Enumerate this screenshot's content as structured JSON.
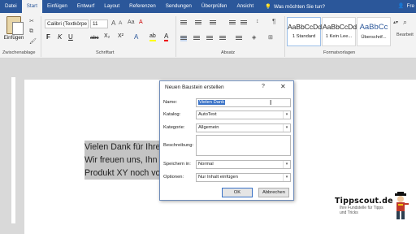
{
  "ribbon_tabs": {
    "file": "Datei",
    "home": "Start",
    "insert": "Einfügen",
    "design": "Entwurf",
    "layout": "Layout",
    "references": "Referenzen",
    "mailings": "Sendungen",
    "review": "Überprüfen",
    "view": "Ansicht",
    "tell_me": "Was möchten Sie tun?",
    "user": "Fre"
  },
  "ribbon": {
    "paste_label": "Einfügen",
    "font_name": "Calibri (Textkörpe",
    "font_size": "11",
    "bold": "F",
    "italic": "K",
    "underline": "U",
    "strike": "abc",
    "subscript": "X₂",
    "superscript": "X²",
    "styles": [
      {
        "preview": "AaBbCcDd",
        "name": "1 Standard"
      },
      {
        "preview": "AaBbCcDd",
        "name": "1 Kein Lee..."
      },
      {
        "preview": "AaBbCc",
        "name": "Überschrif..."
      }
    ],
    "edit_label": "Bearbeit",
    "groups": {
      "clipboard": "Zwischenablage",
      "font": "Schriftart",
      "paragraph": "Absatz",
      "styles": "Formatvorlagen"
    },
    "accent": "#2b579a"
  },
  "document": {
    "lines": [
      "Vielen Dank für Ihre",
      "Wir freuen uns, Ihn",
      "Produkt XY noch vo"
    ]
  },
  "dialog": {
    "title": "Neuen Baustein erstellen",
    "help": "?",
    "close": "✕",
    "fields": {
      "name_label": "Name:",
      "name_value": "Vielen Dank",
      "catalog_label": "Katalog:",
      "catalog_value": "AutoText",
      "category_label": "Kategorie:",
      "category_value": "Allgemein",
      "description_label": "Beschreibung:",
      "save_in_label": "Speichern in:",
      "save_in_value": "Normal",
      "options_label": "Optionen:",
      "options_value": "Nur Inhalt einfügen"
    },
    "ok": "OK",
    "cancel": "Abbrechen"
  },
  "logo": {
    "title": "Tippscout.de",
    "subtitle": "Ihre Fundstelle für Tipps und Tricks"
  }
}
